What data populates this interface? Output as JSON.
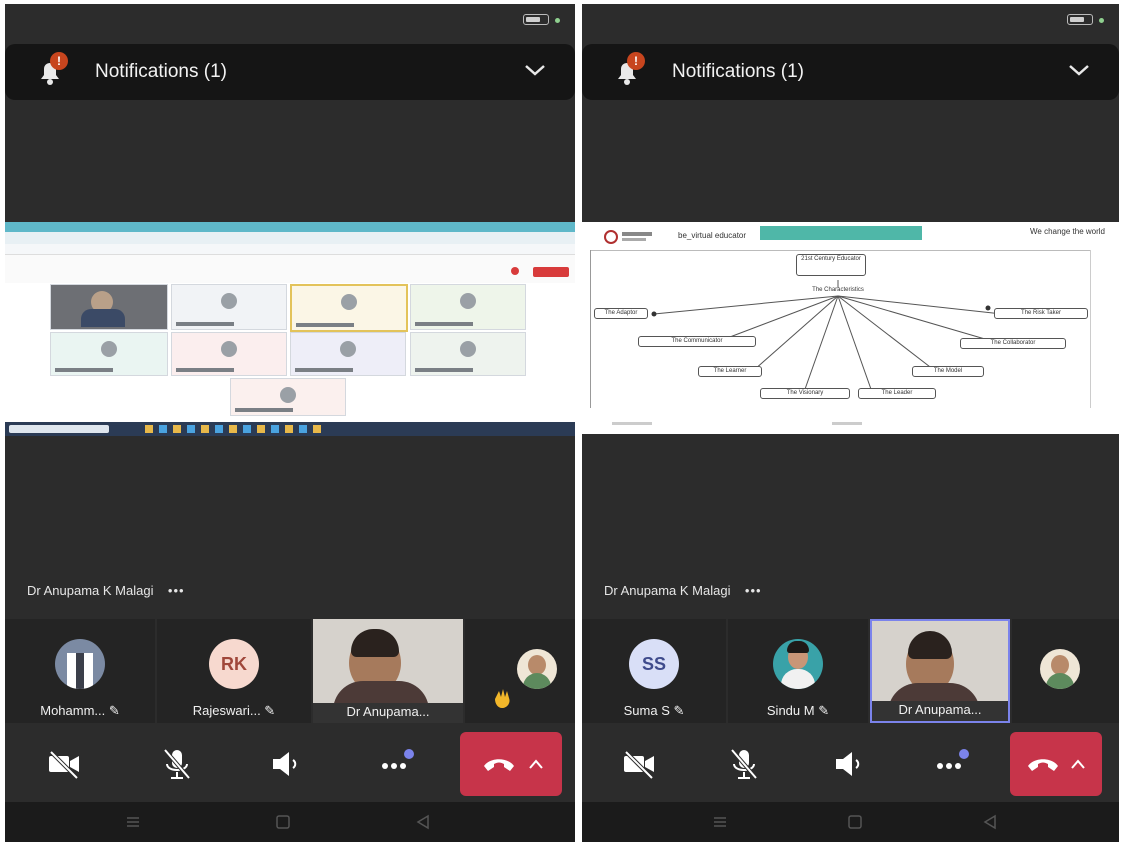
{
  "left": {
    "notification": "Notifications (1)",
    "badge": "!",
    "presenter": "Dr Anupama K Malagi",
    "more": "•••",
    "participants": [
      {
        "label": "Mohamm... ✎"
      },
      {
        "initials": "RK",
        "label": "Rajeswari... ✎"
      },
      {
        "label": "Dr Anupama..."
      }
    ]
  },
  "right": {
    "notification": "Notifications (1)",
    "badge": "!",
    "presenter": "Dr Anupama K Malagi",
    "more": "•••",
    "participants": [
      {
        "initials": "SS",
        "label": "Suma S ✎"
      },
      {
        "label": "Sindu M ✎"
      },
      {
        "label": "Dr Anupama..."
      }
    ],
    "mindmap": {
      "root": "21st Century Educator",
      "hub": "The Characteristics",
      "nodes": [
        "The Adaptor",
        "The Communicator",
        "The Learner",
        "The Visionary",
        "The Leader",
        "The Model",
        "The Collaborator",
        "The Risk Taker"
      ],
      "header_left": "be_virtual educator",
      "header_right": "We change the world"
    }
  },
  "colors": {
    "end_call": "#c7344a",
    "background": "#2c2c2c",
    "accent": "#7b83eb"
  }
}
